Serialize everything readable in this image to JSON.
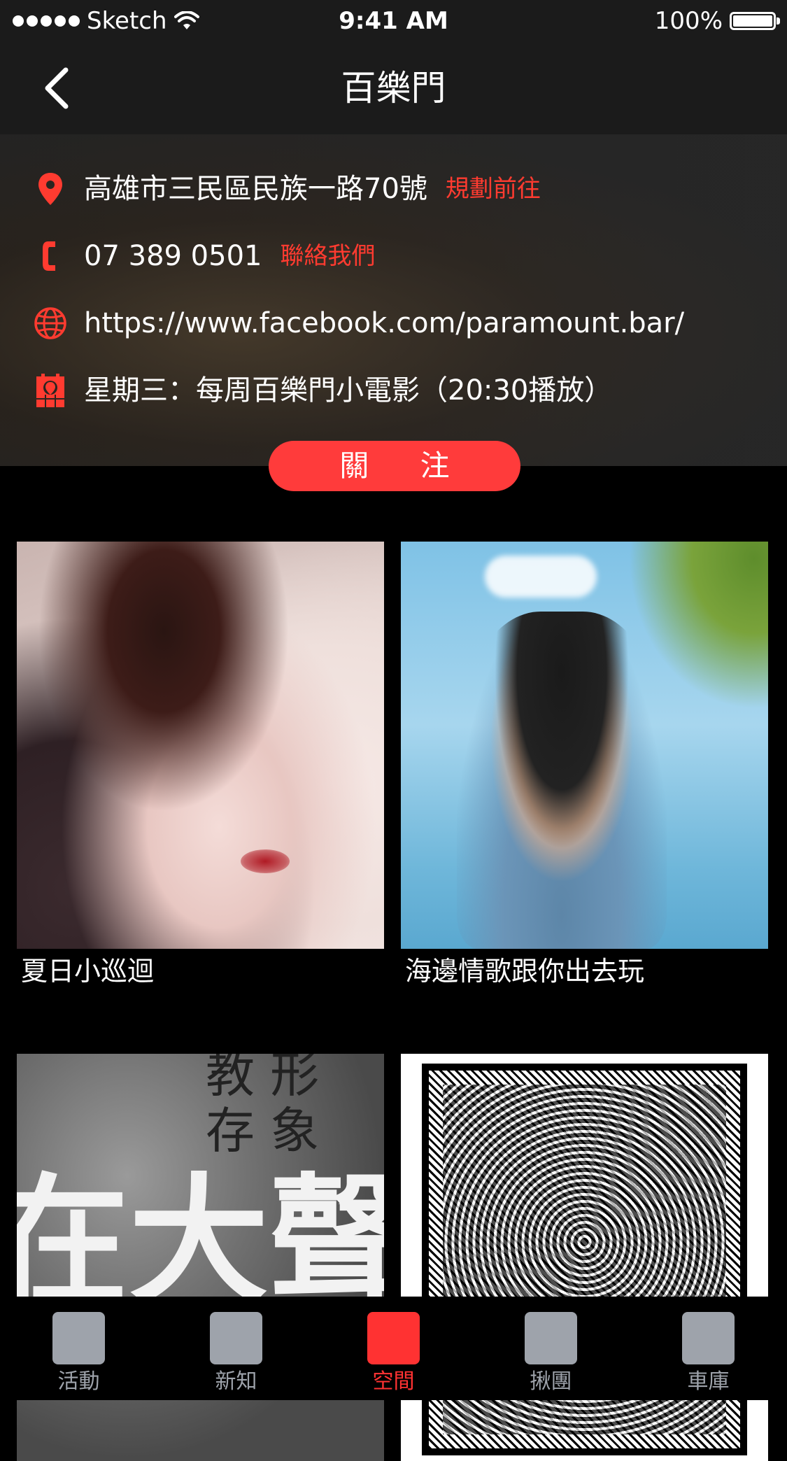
{
  "status_bar": {
    "carrier": "Sketch",
    "time": "9:41 AM",
    "battery": "100%"
  },
  "nav": {
    "title": "百樂門"
  },
  "info": {
    "address": "高雄市三民區民族一路70號",
    "address_action": "規劃前往",
    "phone": "07 389 0501",
    "phone_action": "聯絡我們",
    "website": "https://www.facebook.com/paramount.bar/",
    "schedule": "星期三：每周百樂門小電影（20:30播放）"
  },
  "follow_button": "關 注",
  "events": [
    {
      "title": "夏日小巡迴"
    },
    {
      "title": "海邊情歌跟你出去玩"
    },
    {
      "title": "",
      "image_text_top": "教 形\n存 象",
      "image_text": "在大聲"
    },
    {
      "title": ""
    }
  ],
  "tabs": [
    {
      "label": "活動",
      "active": false
    },
    {
      "label": "新知",
      "active": false
    },
    {
      "label": "空間",
      "active": true
    },
    {
      "label": "揪團",
      "active": false
    },
    {
      "label": "車庫",
      "active": false
    }
  ],
  "colors": {
    "accent": "#ff3b30",
    "tab_inactive": "#9ea3ab",
    "background": "#000000",
    "header": "#1b1b1b"
  }
}
